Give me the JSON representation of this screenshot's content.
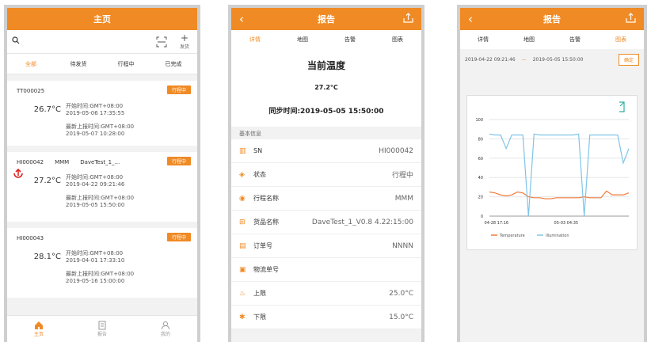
{
  "colors": {
    "accent": "#f08a24",
    "alert": "#e02020",
    "chart_blue": "#7fc4e8",
    "chart_orange": "#f07a3a"
  },
  "screen1": {
    "title": "主页",
    "add_label": "发货",
    "tabs": [
      "全部",
      "待发货",
      "行程中",
      "已完成"
    ],
    "cards": [
      {
        "id": "TT000025",
        "name": "",
        "device": "",
        "badge": "行程中",
        "temp": "26.7°C",
        "start_label": "开始时间:GMT+08:00",
        "start_time": "2019-05-06 17:35:55",
        "report_label": "最新上报时间:GMT+08:00",
        "report_time": "2019-05-07 10:28:00"
      },
      {
        "id": "HI000042",
        "name": "MMM",
        "device": "DaveTest_1_...",
        "badge": "行程中",
        "temp": "27.2°C",
        "start_label": "开始时间:GMT+08:00",
        "start_time": "2019-04-22 09:21:46",
        "report_label": "最新上报时间:GMT+08:00",
        "report_time": "2019-05-05 15:50:00"
      },
      {
        "id": "HI000043",
        "name": "",
        "device": "",
        "badge": "行程中",
        "temp": "28.1°C",
        "start_label": "开始时间:GMT+08:00",
        "start_time": "2019-04-01 17:33:10",
        "report_label": "最新上报时间:GMT+08:00",
        "report_time": "2019-05-16 15:00:00"
      }
    ],
    "nav": [
      "主页",
      "报告",
      "我的"
    ]
  },
  "screen2": {
    "title": "报告",
    "tabs": [
      "详情",
      "地图",
      "告警",
      "图表"
    ],
    "current_title": "当前温度",
    "current_temp": "27.2°C",
    "sync_time": "同步时间:2019-05-05 15:50:00",
    "section": "基本信息",
    "rows": [
      {
        "icon": "barcode-icon",
        "label": "SN",
        "value": "HI000042"
      },
      {
        "icon": "status-icon",
        "label": "状态",
        "value": "行程中"
      },
      {
        "icon": "location-icon",
        "label": "行程名称",
        "value": "MMM"
      },
      {
        "icon": "goods-icon",
        "label": "货品名称",
        "value": "DaveTest_1_V0.8 4.22:15:00"
      },
      {
        "icon": "document-icon",
        "label": "订单号",
        "value": "NNNN"
      },
      {
        "icon": "truck-icon",
        "label": "物流单号",
        "value": ""
      },
      {
        "icon": "fire-icon",
        "label": "上限",
        "value": "25.0°C"
      },
      {
        "icon": "snow-icon",
        "label": "下限",
        "value": "15.0°C"
      }
    ]
  },
  "screen3": {
    "title": "报告",
    "tabs": [
      "详情",
      "地图",
      "告警",
      "图表"
    ],
    "date_from": "2019-04-22 09:21:46",
    "date_to": "2019-05-05 15:50:00",
    "query": "确定"
  },
  "chart_data": {
    "type": "line",
    "title": "",
    "xlabel": "",
    "ylabel": "",
    "x_ticks": [
      "04-28 17:16",
      "05-03 04:35"
    ],
    "y_ticks": [
      0,
      20,
      40,
      60,
      80,
      100
    ],
    "ylim": [
      0,
      100
    ],
    "legend": [
      "Temperature",
      "Illumination"
    ],
    "legend_position": "bottom",
    "series": [
      {
        "name": "Temperature",
        "x": [
          0,
          2,
          4,
          6,
          8,
          10,
          12,
          14,
          16,
          18,
          20,
          22,
          24,
          26,
          28,
          30,
          32,
          34,
          36,
          38,
          40,
          42,
          44,
          46,
          48,
          50
        ],
        "values": [
          25,
          24,
          22,
          21,
          22,
          25,
          24,
          20,
          19,
          19,
          18,
          18,
          19,
          19,
          19,
          19,
          19,
          20,
          19,
          19,
          19,
          26,
          22,
          22,
          22,
          24
        ]
      },
      {
        "name": "Illumination",
        "x": [
          0,
          2,
          4,
          6,
          8,
          10,
          12,
          14,
          16,
          18,
          20,
          22,
          24,
          26,
          28,
          30,
          32,
          34,
          36,
          38,
          40,
          42,
          44,
          46,
          48,
          50
        ],
        "values": [
          85,
          84,
          84,
          70,
          84,
          84,
          84,
          0,
          85,
          84,
          84,
          84,
          84,
          84,
          84,
          84,
          85,
          0,
          84,
          84,
          84,
          84,
          84,
          84,
          55,
          70
        ]
      }
    ]
  }
}
